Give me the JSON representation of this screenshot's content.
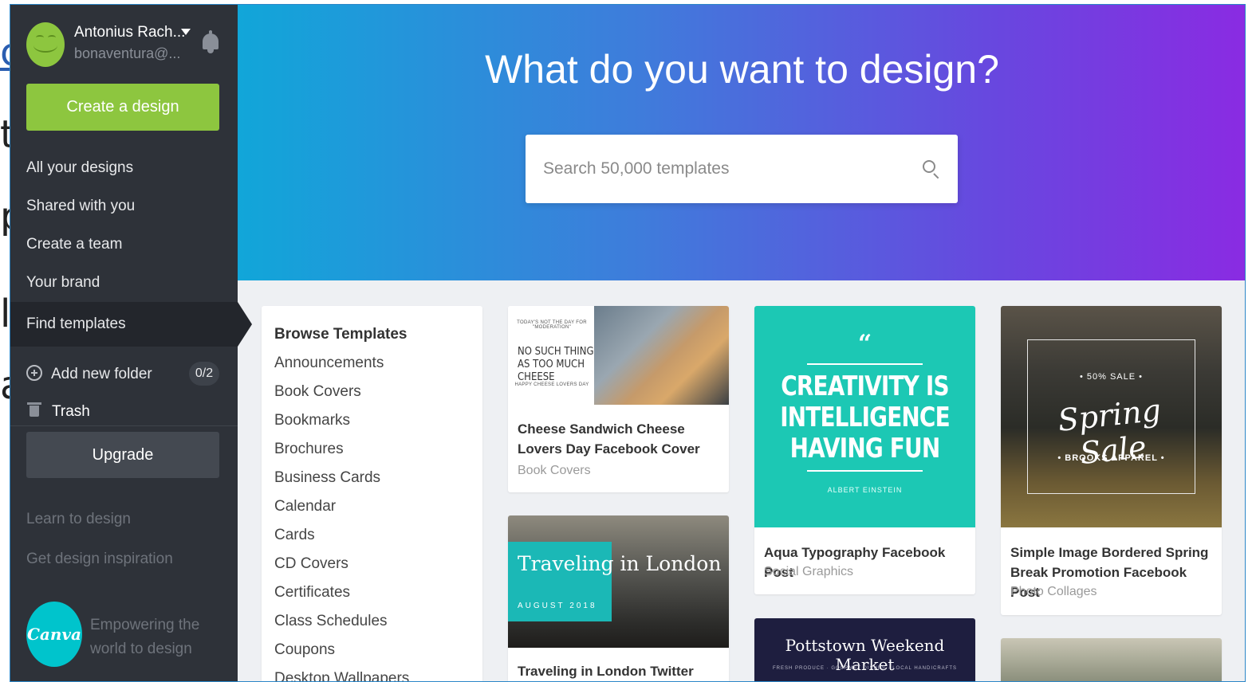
{
  "background": {
    "fragments": [
      "c",
      "t",
      "p",
      "l",
      "a"
    ]
  },
  "user": {
    "name": "Antonius Rach...",
    "email": "bonaventura@..."
  },
  "sidebar": {
    "create_label": "Create a design",
    "nav": [
      {
        "label": "All your designs"
      },
      {
        "label": "Shared with you"
      },
      {
        "label": "Create a team"
      },
      {
        "label": "Your brand"
      },
      {
        "label": "Find templates",
        "active": true
      }
    ],
    "folder": {
      "label": "Add new folder",
      "count": "0/2"
    },
    "trash_label": "Trash",
    "upgrade_label": "Upgrade",
    "learn_label": "Learn to design",
    "inspiration_label": "Get design inspiration",
    "logo_text": "Canva",
    "tagline": "Empowering the world to design"
  },
  "hero": {
    "title": "What do you want to design?",
    "search_placeholder": "Search 50,000 templates"
  },
  "browse": {
    "title": "Browse Templates",
    "items": [
      "Announcements",
      "Book Covers",
      "Bookmarks",
      "Brochures",
      "Business Cards",
      "Calendar",
      "Cards",
      "CD Covers",
      "Certificates",
      "Class Schedules",
      "Coupons",
      "Desktop Wallpapers"
    ]
  },
  "templates": [
    {
      "title": "Cheese Sandwich Cheese Lovers Day Facebook Cover",
      "category": "Book Covers",
      "image_text": {
        "top": "TODAY'S NOT THE DAY FOR \"MODERATION\"",
        "main": "NO SUCH THING AS TOO MUCH CHEESE",
        "bottom": "HAPPY CHEESE LOVERS DAY"
      }
    },
    {
      "title": "Aqua Typography Facebook Post",
      "category": "Social Graphics",
      "image_text": {
        "quote": "“",
        "main": "CREATIVITY IS INTELLIGENCE HAVING FUN",
        "author": "ALBERT EINSTEIN"
      }
    },
    {
      "title": "Simple Image Bordered Spring Break Promotion Facebook Post",
      "category": "Photo Collages",
      "image_text": {
        "top": "• 50% SALE •",
        "script": "Spring Sale",
        "brand": "• BROOKS APPAREL •"
      }
    },
    {
      "title": "Traveling in London Twitter Post",
      "image_text": {
        "main": "Traveling in London",
        "date": "AUGUST 2018"
      }
    },
    {
      "image_text": {
        "main": "Pottstown Weekend Market",
        "sub": "FRESH PRODUCE · GOURMET DISHES · LOCAL HANDICRAFTS"
      }
    }
  ]
}
